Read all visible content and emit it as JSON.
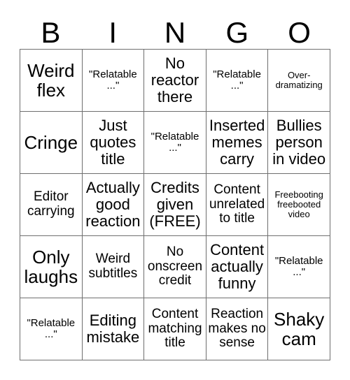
{
  "card": {
    "title_letters": [
      "B",
      "I",
      "N",
      "G",
      "O"
    ],
    "rows": 5,
    "columns": 5,
    "border_color": "#6f6f6f",
    "text_color": "#000000",
    "background_color": "#ffffff",
    "cells": [
      {
        "text": "Weird flex",
        "size": "xl",
        "marked": false
      },
      {
        "text": "\"Relatable ...\"",
        "size": "sm",
        "marked": false
      },
      {
        "text": "No reactor there",
        "size": "lg",
        "marked": false
      },
      {
        "text": "\"Relatable ...\"",
        "size": "sm",
        "marked": false
      },
      {
        "text": "Over-dramatizing",
        "size": "xs",
        "marked": false
      },
      {
        "text": "Cringe",
        "size": "xl",
        "marked": false
      },
      {
        "text": "Just quotes title",
        "size": "lg",
        "marked": false
      },
      {
        "text": "\"Relatable ...\"",
        "size": "sm",
        "marked": false
      },
      {
        "text": "Inserted memes carry",
        "size": "lg",
        "marked": false
      },
      {
        "text": "Bullies person in video",
        "size": "lg",
        "marked": false
      },
      {
        "text": "Editor carrying",
        "size": "md",
        "marked": false
      },
      {
        "text": "Actually good reaction",
        "size": "lg",
        "marked": false
      },
      {
        "text": "Credits given (FREE)",
        "size": "lg",
        "marked": false
      },
      {
        "text": "Content unrelated to title",
        "size": "md",
        "marked": false
      },
      {
        "text": "Freebooting freebooted video",
        "size": "xs",
        "marked": false
      },
      {
        "text": "Only laughs",
        "size": "xl",
        "marked": false
      },
      {
        "text": "Weird subtitles",
        "size": "md",
        "marked": false
      },
      {
        "text": "No onscreen credit",
        "size": "md",
        "marked": false
      },
      {
        "text": "Content actually funny",
        "size": "lg",
        "marked": false
      },
      {
        "text": "\"Relatable ...\"",
        "size": "sm",
        "marked": false
      },
      {
        "text": "\"Relatable ...\"",
        "size": "sm",
        "marked": false
      },
      {
        "text": "Editing mistake",
        "size": "lg",
        "marked": false
      },
      {
        "text": "Content matching title",
        "size": "md",
        "marked": false
      },
      {
        "text": "Reaction makes no sense",
        "size": "md",
        "marked": false
      },
      {
        "text": "Shaky cam",
        "size": "xl",
        "marked": false
      }
    ]
  }
}
